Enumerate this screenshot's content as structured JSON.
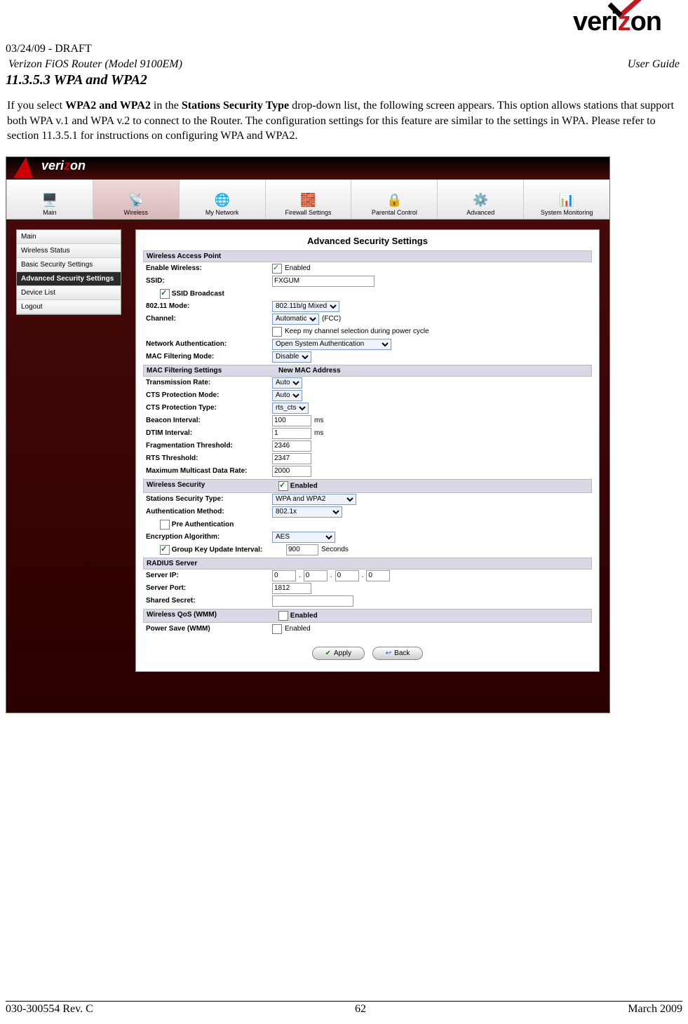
{
  "header": {
    "brand": "verizon",
    "draft": "03/24/09 - DRAFT",
    "model": "Verizon FiOS Router (Model 9100EM)",
    "doc_type": "User Guide"
  },
  "section": {
    "number": "11.3.5.3",
    "title": "WPA and WPA2"
  },
  "paragraph": {
    "pre": "If you select ",
    "b1": "WPA2 and WPA2",
    "mid1": " in the ",
    "b2": "Stations Security Type",
    "rest": " drop-down list, the following screen appears.  This option allows stations that support both WPA v.1 and WPA v.2 to connect to the Router. The configuration settings for this feature are similar to the settings in WPA. Please refer to section 11.3.5.1 for instructions on configuring WPA and WPA2."
  },
  "ui": {
    "brand": "verizon",
    "tabs": [
      "Main",
      "Wireless",
      "My Network",
      "Firewall Settings",
      "Parental Control",
      "Advanced",
      "System Monitoring"
    ],
    "tab_icons": [
      "🖥️",
      "📡",
      "🌐",
      "🧱",
      "🔒",
      "⚙️",
      "📊"
    ],
    "active_tab": 1,
    "sidebar": [
      "Main",
      "Wireless Status",
      "Basic Security Settings",
      "Advanced Security Settings",
      "Device List",
      "Logout"
    ],
    "active_side": 3,
    "title": "Advanced Security Settings",
    "sec1": "Wireless Access Point",
    "rows": {
      "enable_wireless_lbl": "Enable Wireless:",
      "enable_wireless_chk": true,
      "enable_wireless_txt": "Enabled",
      "ssid_lbl": "SSID:",
      "ssid_val": "FXGUM",
      "ssid_bcast_chk": true,
      "ssid_bcast_txt": "SSID Broadcast",
      "mode_lbl": "802.11 Mode:",
      "mode_val": "802.11b/g Mixed",
      "channel_lbl": "Channel:",
      "channel_val": "Automatic",
      "channel_suffix": "(FCC)",
      "keep_ch_chk": false,
      "keep_ch_txt": "Keep my channel selection during power cycle",
      "netauth_lbl": "Network Authentication:",
      "netauth_val": "Open System Authentication",
      "macmode_lbl": "MAC Filtering Mode:",
      "macmode_val": "Disable",
      "macfilt_hdr1": "MAC Filtering Settings",
      "macfilt_hdr2": "New MAC Address",
      "txrate_lbl": "Transmission Rate:",
      "txrate_val": "Auto",
      "ctsmode_lbl": "CTS Protection Mode:",
      "ctsmode_val": "Auto",
      "ctstype_lbl": "CTS Protection Type:",
      "ctstype_val": "rts_cts",
      "beacon_lbl": "Beacon Interval:",
      "beacon_val": "100",
      "beacon_unit": "ms",
      "dtim_lbl": "DTIM Interval:",
      "dtim_val": "1",
      "dtim_unit": "ms",
      "frag_lbl": "Fragmentation Threshold:",
      "frag_val": "2346",
      "rts_lbl": "RTS Threshold:",
      "rts_val": "2347",
      "mcast_lbl": "Maximum Multicast Data Rate:",
      "mcast_val": "2000",
      "wsec_hdr": "Wireless Security",
      "wsec_chk": true,
      "wsec_txt": "Enabled",
      "stations_lbl": "Stations Security Type:",
      "stations_val": "WPA and WPA2",
      "authm_lbl": "Authentication Method:",
      "authm_val": "802.1x",
      "preauth_chk": false,
      "preauth_txt": "Pre Authentication",
      "encalg_lbl": "Encryption Algorithm:",
      "encalg_val": "AES",
      "gkey_chk": true,
      "gkey_txt": "Group Key Update Interval:",
      "gkey_val": "900",
      "gkey_unit": "Seconds",
      "radius_hdr": "RADIUS Server",
      "sip_lbl": "Server IP:",
      "sip_a": "0",
      "sip_b": "0",
      "sip_c": "0",
      "sip_d": "0",
      "sport_lbl": "Server Port:",
      "sport_val": "1812",
      "secret_lbl": "Shared Secret:",
      "secret_val": "",
      "qos_hdr": "Wireless QoS (WMM)",
      "qos_chk": false,
      "qos_txt": "Enabled",
      "ps_lbl": "Power Save (WMM)",
      "ps_chk": false,
      "ps_txt": "Enabled"
    },
    "buttons": {
      "apply": "Apply",
      "back": "Back"
    }
  },
  "footer": {
    "left": "030-300554 Rev. C",
    "center": "62",
    "right": "March 2009"
  }
}
